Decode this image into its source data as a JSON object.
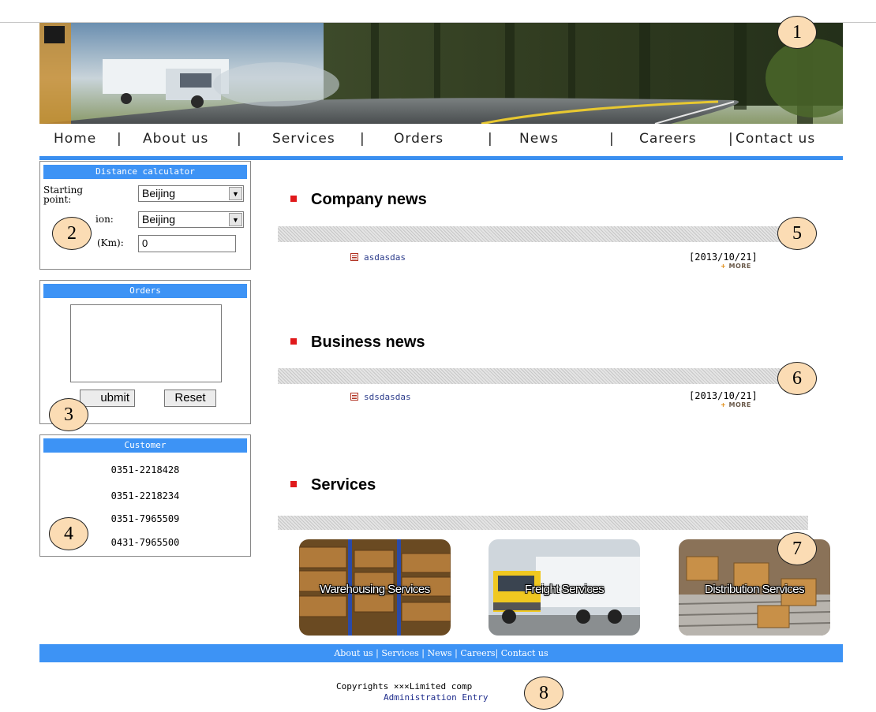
{
  "nav": {
    "items": [
      "Home",
      "About us",
      "Services",
      "Orders",
      "News",
      "Careers",
      "Contact us"
    ],
    "separator": "|"
  },
  "calculator": {
    "title": "Distance calculator",
    "starting_label_line1": "Starting",
    "starting_label_line2": "point:",
    "starting_value": "Beijing",
    "destination_label": "ion:",
    "destination_value": "Beijing",
    "distance_label": "(Km):",
    "distance_value": "0"
  },
  "orders": {
    "title": "Orders",
    "textarea_value": "",
    "submit_label": "ubmit",
    "reset_label": "Reset"
  },
  "customer": {
    "title": "Customer",
    "phones": [
      "0351-2218428",
      "0351-2218234",
      "0351-7965509",
      "0431-7965500"
    ]
  },
  "sections": {
    "company_news": {
      "title": "Company news",
      "items": [
        {
          "title": "asdasdas",
          "date": "[2013/10/21]"
        }
      ],
      "more": "MORE"
    },
    "business_news": {
      "title": "Business news",
      "items": [
        {
          "title": "sdsdasdas",
          "date": "[2013/10/21]"
        }
      ],
      "more": "MORE"
    },
    "services": {
      "title": "Services",
      "cards": [
        {
          "label": "Warehousing Services"
        },
        {
          "label": "Freight Services"
        },
        {
          "label": "Distribution Services"
        }
      ]
    }
  },
  "footer": {
    "links": [
      "About us",
      "Services",
      "News",
      "Careers",
      "Contact us"
    ],
    "copyright": "Copyrights ×××Limited comp",
    "admin_link": "Administration Entry"
  },
  "markers": [
    "1",
    "2",
    "3",
    "4",
    "5",
    "6",
    "7",
    "8"
  ],
  "colors": {
    "accent_blue": "#3d93f5",
    "bullet_red": "#e0191b",
    "marker_fill": "#fbdcb4"
  }
}
